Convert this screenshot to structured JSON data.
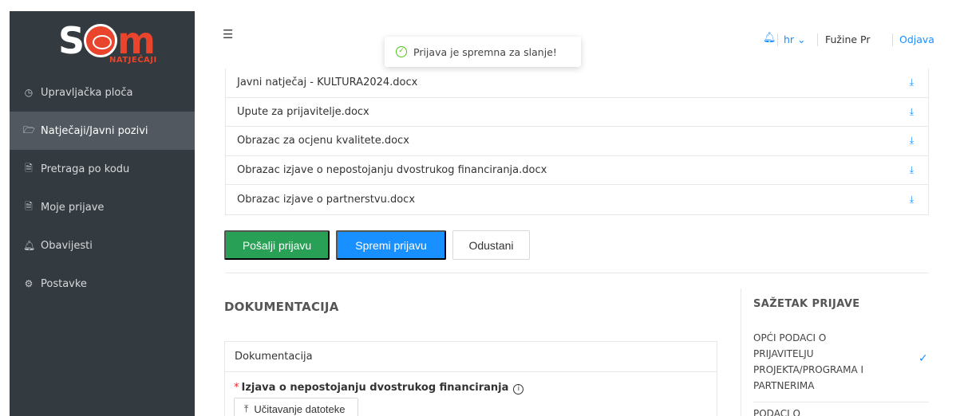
{
  "logo": {
    "sub": "NATJEČAJI"
  },
  "sidebar": {
    "items": [
      {
        "icon": "dashboard-icon",
        "label": "Upravljačka ploča",
        "active": false
      },
      {
        "icon": "folder-open-icon",
        "label": "Natječaji/Javni pozivi",
        "active": true
      },
      {
        "icon": "file-search-icon",
        "label": "Pretraga po kodu",
        "active": false
      },
      {
        "icon": "file-icon",
        "label": "Moje prijave",
        "active": false
      },
      {
        "icon": "bell-icon",
        "label": "Obavijesti",
        "active": false
      },
      {
        "icon": "gear-icon",
        "label": "Postavke",
        "active": false
      }
    ]
  },
  "header": {
    "toast": "Prijava je spremna za slanje!",
    "language": "hr",
    "user": "Fužine Pr",
    "logout": "Odjava"
  },
  "files": [
    "Javni natječaj - KULTURA2024.docx",
    "Upute za prijavitelje.docx",
    "Obrazac za ocjenu kvalitete.docx",
    "Obrazac izjave o nepostojanju dvostrukog financiranja.docx",
    "Obrazac izjave o partnerstvu.docx"
  ],
  "actions": {
    "send": "Pošalji prijavu",
    "save": "Spremi prijavu",
    "cancel": "Odustani"
  },
  "documentation": {
    "title": "DOKUMENTACIJA",
    "card_title": "Dokumentacija",
    "field_label": "Izjava o nepostojanju dvostrukog financiranja",
    "upload_label": "Učitavanje datoteke"
  },
  "summary": {
    "title": "SAŽETAK PRIJAVE",
    "item1": "OPĆI PODACI O PRIJAVITELJU PROJEKTA/PROGRAMA I PARTNERIMA",
    "item2": "PODACI O"
  },
  "colors": {
    "sidebar_bg": "#333a40",
    "sidebar_active": "#515860",
    "primary": "#1890ff",
    "success": "#28a055",
    "brand": "#e8452c"
  }
}
